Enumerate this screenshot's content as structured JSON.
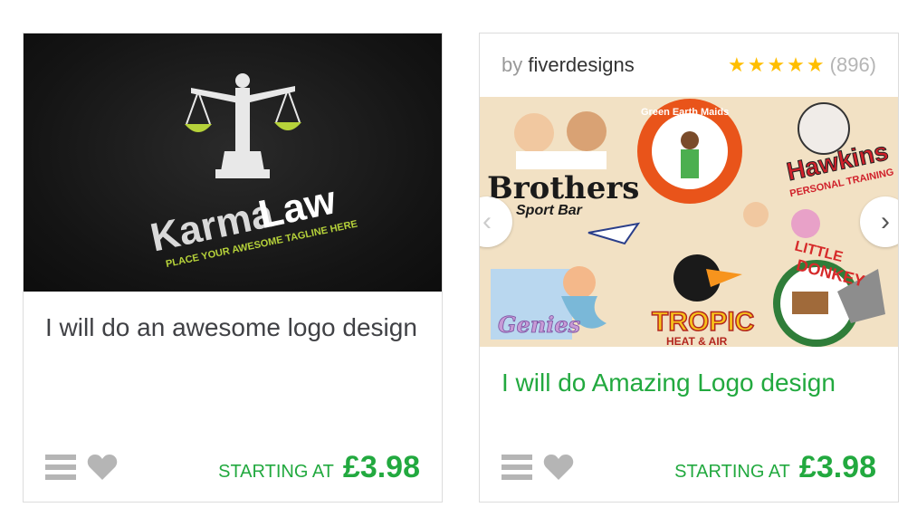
{
  "cards": [
    {
      "title": "I will do an awesome logo design",
      "thumbnail": {
        "logo_name_part1": "Karma",
        "logo_name_part2": "Law",
        "tagline": "PLACE YOUR AWESOME TAGLINE HERE"
      },
      "price_label": "STARTING AT",
      "price": "£3.98"
    },
    {
      "seller_prefix": "by",
      "seller_name": "fiverdesigns",
      "stars": "★★★★★",
      "rating_count": "(896)",
      "title": "I will do Amazing Logo design",
      "thumbnail": {
        "logo1_line1": "Brothers",
        "logo1_line2": "Sport Bar",
        "logo2": "Green Earth Maids",
        "logo3_line1": "Hawkins",
        "logo3_line2": "PERSONAL TRAINING",
        "logo4": "Genies",
        "logo5_line1": "TROPIC",
        "logo5_line2": "HEAT & AIR",
        "logo6_line1": "LITTLE",
        "logo6_line2": "DONKEY"
      },
      "carousel_prev": "‹",
      "carousel_next": "›",
      "price_label": "STARTING AT",
      "price": "£3.98"
    }
  ],
  "colors": {
    "accent_green": "#22a93f",
    "star_yellow": "#ffbe00",
    "icon_gray": "#b5b5b5"
  }
}
